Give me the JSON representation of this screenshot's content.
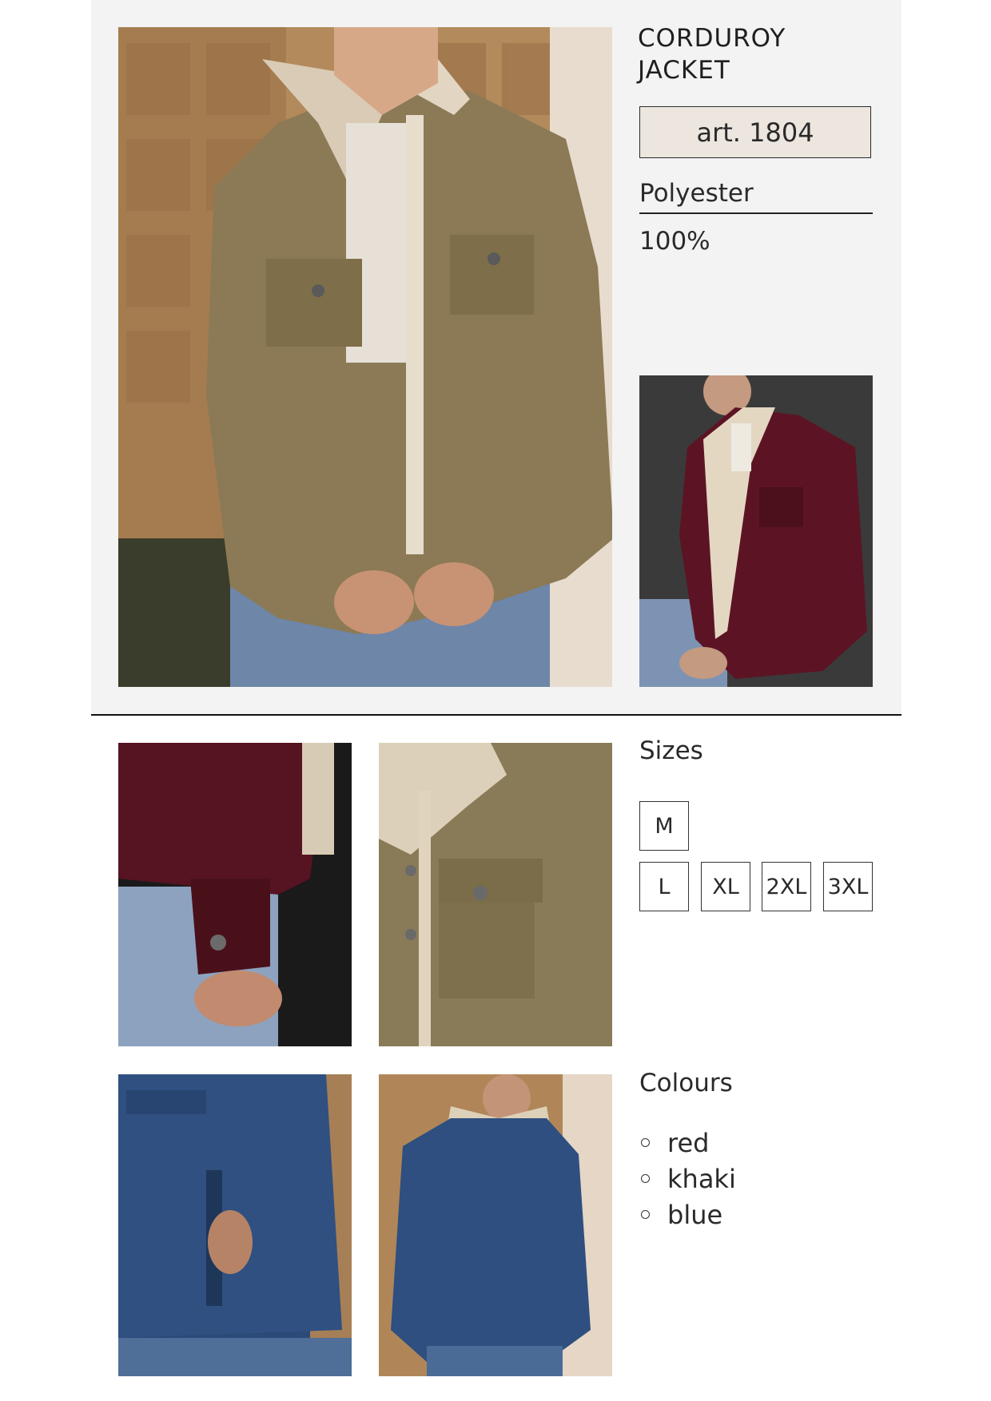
{
  "product": {
    "title_line1": "CORDUROY",
    "title_line2": "JACKET",
    "article": "art. 1804",
    "material": "Polyester",
    "material_percent": "100%"
  },
  "sizes": {
    "label": "Sizes",
    "options": [
      "M",
      "L",
      "XL",
      "2XL",
      "3XL"
    ]
  },
  "colours": {
    "label": "Colours",
    "options": [
      "red",
      "khaki",
      "blue"
    ]
  },
  "photos": [
    {
      "icon": "main-khaki-jacket-photo",
      "colour": "#8b7a55"
    },
    {
      "icon": "red-jacket-photo",
      "colour": "#5c1424"
    },
    {
      "icon": "red-sleeve-detail-photo",
      "colour": "#4a1019"
    },
    {
      "icon": "khaki-pocket-detail-photo",
      "colour": "#8a7b58"
    },
    {
      "icon": "blue-pocket-detail-photo",
      "colour": "#2b4a78"
    },
    {
      "icon": "blue-jacket-back-photo",
      "colour": "#2e4f80"
    }
  ]
}
